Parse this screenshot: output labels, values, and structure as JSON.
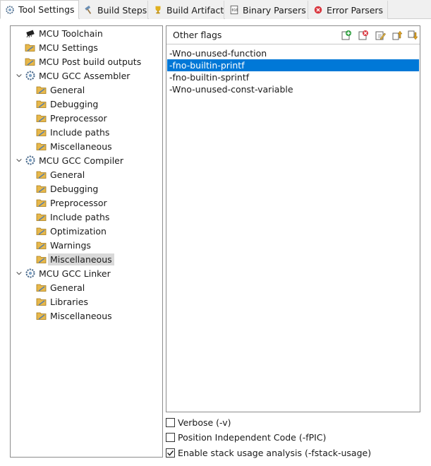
{
  "tabs": [
    {
      "label": "Tool Settings",
      "icon": "gear-icon",
      "active": true
    },
    {
      "label": "Build Steps",
      "icon": "hammer-icon",
      "active": false
    },
    {
      "label": "Build Artifact",
      "icon": "trophy-icon",
      "active": false
    },
    {
      "label": "Binary Parsers",
      "icon": "binary-file-icon",
      "active": false
    },
    {
      "label": "Error Parsers",
      "icon": "error-icon",
      "active": false
    }
  ],
  "tree": [
    {
      "label": "MCU Toolchain",
      "icon": "chip-icon"
    },
    {
      "label": "MCU Settings",
      "icon": "settings-folder-icon"
    },
    {
      "label": "MCU Post build outputs",
      "icon": "settings-folder-icon"
    },
    {
      "label": "MCU GCC Assembler",
      "icon": "gear-icon",
      "expanded": true
    },
    {
      "label": "General",
      "icon": "settings-folder-icon"
    },
    {
      "label": "Debugging",
      "icon": "settings-folder-icon"
    },
    {
      "label": "Preprocessor",
      "icon": "settings-folder-icon"
    },
    {
      "label": "Include paths",
      "icon": "settings-folder-icon"
    },
    {
      "label": "Miscellaneous",
      "icon": "settings-folder-icon"
    },
    {
      "label": "MCU GCC Compiler",
      "icon": "gear-icon",
      "expanded": true
    },
    {
      "label": "General",
      "icon": "settings-folder-icon"
    },
    {
      "label": "Debugging",
      "icon": "settings-folder-icon"
    },
    {
      "label": "Preprocessor",
      "icon": "settings-folder-icon"
    },
    {
      "label": "Include paths",
      "icon": "settings-folder-icon"
    },
    {
      "label": "Optimization",
      "icon": "settings-folder-icon"
    },
    {
      "label": "Warnings",
      "icon": "settings-folder-icon"
    },
    {
      "label": "Miscellaneous",
      "icon": "settings-folder-icon",
      "selected": true
    },
    {
      "label": "MCU GCC Linker",
      "icon": "gear-icon",
      "expanded": true
    },
    {
      "label": "General",
      "icon": "settings-folder-icon"
    },
    {
      "label": "Libraries",
      "icon": "settings-folder-icon"
    },
    {
      "label": "Miscellaneous",
      "icon": "settings-folder-icon"
    }
  ],
  "flags_panel": {
    "title": "Other flags",
    "toolbar": [
      "add-icon",
      "delete-icon",
      "edit-icon",
      "move-up-icon",
      "move-down-icon"
    ],
    "items": [
      {
        "value": "-Wno-unused-function",
        "selected": false
      },
      {
        "value": "-fno-builtin-printf",
        "selected": true
      },
      {
        "value": "-fno-builtin-sprintf",
        "selected": false
      },
      {
        "value": "-Wno-unused-const-variable",
        "selected": false
      }
    ]
  },
  "options": [
    {
      "label": "Verbose (-v)",
      "checked": false
    },
    {
      "label": "Position Independent Code (-fPIC)",
      "checked": false
    },
    {
      "label": "Enable stack usage analysis (-fstack-usage)",
      "checked": true
    }
  ],
  "colors": {
    "selection": "#0078d7",
    "tree_selection": "#d9d9d9"
  }
}
